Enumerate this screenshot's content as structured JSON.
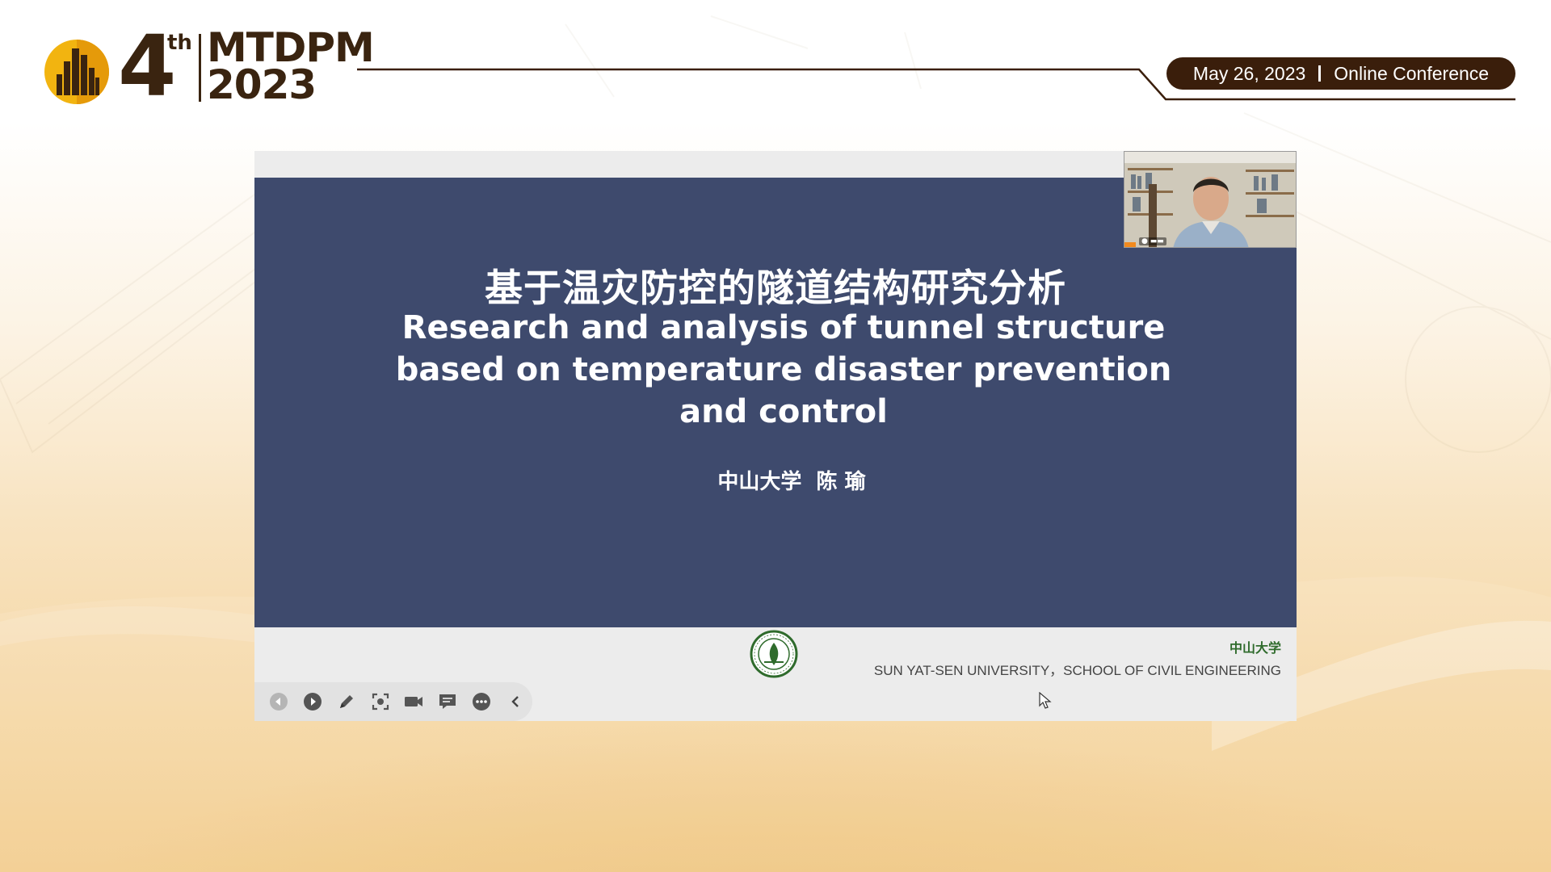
{
  "header": {
    "edition_number": "4",
    "edition_suffix": "th",
    "conference_name": "MTDPM",
    "conference_year": "2023",
    "date": "May 26, 2023",
    "format": "Online Conference"
  },
  "slide": {
    "title_cn": "基于温灾防控的隧道结构研究分析",
    "title_en_lines": [
      "Research and analysis of tunnel structure",
      "based on temperature disaster prevention",
      "and control"
    ],
    "author": "中山大学  陈 瑜",
    "university_cn": "中山大学",
    "university_en": "SUN YAT-SEN UNIVERSITY，SCHOOL OF CIVIL ENGINEERING"
  },
  "toolbar": {
    "buttons": [
      "previous-slide",
      "next-slide",
      "pen",
      "screenshot",
      "camera",
      "chat",
      "more",
      "collapse"
    ]
  },
  "colors": {
    "brand_dark": "#3a1e0b",
    "logo_gold": "#f2b410",
    "slide_bg": "#3e4a6d",
    "seal_green": "#2f6b2c"
  }
}
